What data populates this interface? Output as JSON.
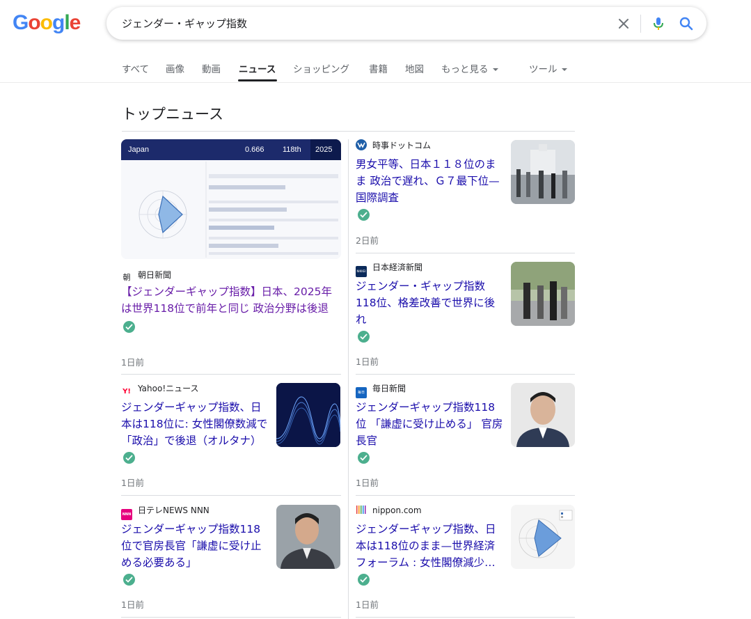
{
  "logo": {
    "letters": [
      "G",
      "o",
      "o",
      "g",
      "l",
      "e"
    ]
  },
  "search": {
    "query": "ジェンダー・ギャップ指数"
  },
  "tabs": [
    {
      "label": "すべて"
    },
    {
      "label": "画像"
    },
    {
      "label": "動画"
    },
    {
      "label": "ニュース"
    },
    {
      "label": "ショッピング"
    },
    {
      "label": "書籍"
    },
    {
      "label": "地図"
    },
    {
      "label": "もっと見る"
    },
    {
      "label": "ツール"
    }
  ],
  "section": {
    "title": "トップニュース"
  },
  "featured": {
    "image": {
      "country": "Japan",
      "score": "0.666",
      "rank": "118th",
      "year": "2025"
    },
    "source": "朝日新聞",
    "source_logo": "朝",
    "headline": "【ジェンダーギャップ指数】日本、2025年は世界118位で前年と同じ 政治分野は後退",
    "time": "1日前"
  },
  "articles": [
    {
      "source": "時事ドットコム",
      "headline": "男女平等、日本１１８位のまま 政治で遅れ、Ｇ７最下位—国際調査",
      "time": "2日前"
    },
    {
      "source": "日本経済新聞",
      "source_logo": "NIKKEI",
      "headline": "ジェンダー・ギャップ指数118位、格差改善で世界に後れ",
      "time": "1日前"
    },
    {
      "source": "Yahoo!ニュース",
      "source_logo": "Y!",
      "headline": "ジェンダーギャップ指数、日本は118位に: 女性閣僚数減で「政治」で後退（オルタナ）",
      "time": "1日前"
    },
    {
      "source": "毎日新聞",
      "source_logo": "毎日",
      "headline": "ジェンダーギャップ指数118位 「謙虚に受け止める」 官房長官",
      "time": "1日前"
    },
    {
      "source": "日テレNEWS NNN",
      "source_logo": "NNN",
      "headline": "ジェンダーギャップ指数118位で官房長官「謙虚に受け止める必要ある」",
      "time": "1日前"
    },
    {
      "source": "nippon.com",
      "headline": "ジェンダーギャップ指数、日本は118位のまま—世界経済フォーラム : 女性閣僚減少…",
      "time": "1日前"
    }
  ],
  "colors": {
    "link": "#1a0dab",
    "visited": "#681da8",
    "verified": "#4caf8e",
    "text_secondary": "#70757a"
  }
}
